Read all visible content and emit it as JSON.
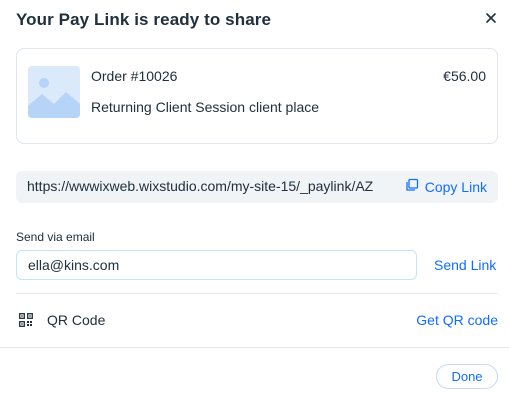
{
  "dialog": {
    "title": "Your Pay Link is ready to share"
  },
  "order": {
    "id_label": "Order #10026",
    "price": "€56.00",
    "description": "Returning Client Session client place",
    "image_icon": "image-placeholder-icon"
  },
  "paylink": {
    "url": "https://wwwixweb.wixstudio.com/my-site-15/_paylink/AZ",
    "copy_label": "Copy Link",
    "copy_icon": "copy-icon"
  },
  "email": {
    "label": "Send via email",
    "value": "ella@kins.com",
    "send_label": "Send Link"
  },
  "qr": {
    "icon": "qr-code-icon",
    "label": "QR Code",
    "action_label": "Get QR code"
  },
  "footer": {
    "done_label": "Done"
  },
  "colors": {
    "accent": "#116dff",
    "text": "#20303c",
    "border": "#dfe5eb",
    "link_bg": "#f0f4f7",
    "thumb_bg": "#dbeafb"
  }
}
